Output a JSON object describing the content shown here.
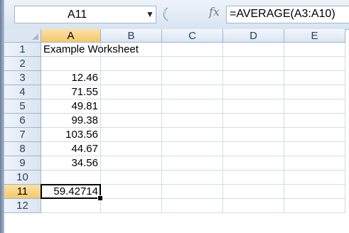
{
  "formula_bar": {
    "name_box": "A11",
    "fx_label": "fx",
    "formula": "=AVERAGE(A3:A10)"
  },
  "columns": [
    "A",
    "B",
    "C",
    "D",
    "E"
  ],
  "rows": [
    "1",
    "2",
    "3",
    "4",
    "5",
    "6",
    "7",
    "8",
    "9",
    "10",
    "11",
    "12"
  ],
  "active_cell": "A11",
  "cells": {
    "r1": {
      "A": "Example Worksheet"
    },
    "r3": {
      "A": "12.46"
    },
    "r4": {
      "A": "71.55"
    },
    "r5": {
      "A": "49.81"
    },
    "r6": {
      "A": "99.38"
    },
    "r7": {
      "A": "103.56"
    },
    "r8": {
      "A": "44.67"
    },
    "r9": {
      "A": "34.56"
    },
    "r11": {
      "A": "59.42714"
    }
  },
  "colors": {
    "header_bg": "#dbe5f2",
    "active_header": "#f6c86a",
    "grid_line": "#d4dce8"
  }
}
